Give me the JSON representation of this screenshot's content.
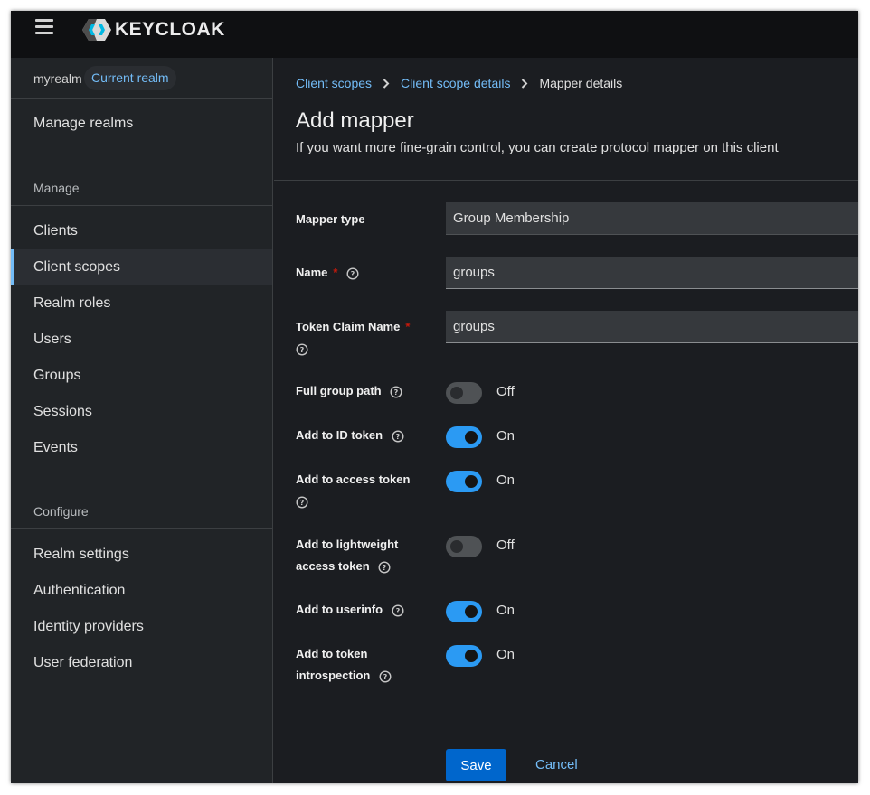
{
  "brand": {
    "logo_text": "KEYCLOAK"
  },
  "realm": {
    "name": "myrealm",
    "badge": "Current realm"
  },
  "sidebar": {
    "manage_realms": "Manage realms",
    "manage_heading": "Manage",
    "manage_items": [
      {
        "label": "Clients",
        "active": false
      },
      {
        "label": "Client scopes",
        "active": true
      },
      {
        "label": "Realm roles",
        "active": false
      },
      {
        "label": "Users",
        "active": false
      },
      {
        "label": "Groups",
        "active": false
      },
      {
        "label": "Sessions",
        "active": false
      },
      {
        "label": "Events",
        "active": false
      }
    ],
    "configure_heading": "Configure",
    "configure_items": [
      {
        "label": "Realm settings"
      },
      {
        "label": "Authentication"
      },
      {
        "label": "Identity providers"
      },
      {
        "label": "User federation"
      }
    ]
  },
  "breadcrumb": {
    "items": [
      "Client scopes",
      "Client scope details"
    ],
    "current": "Mapper details"
  },
  "page": {
    "title": "Add mapper",
    "subtitle": "If you want more fine-grain control, you can create protocol mapper on this client"
  },
  "form": {
    "mapper_type": {
      "label": "Mapper type",
      "value": "Group Membership"
    },
    "name": {
      "label": "Name",
      "value": "groups",
      "required": true
    },
    "token_claim_name": {
      "label": "Token Claim Name",
      "value": "groups",
      "required": true
    },
    "toggles": [
      {
        "label": "Full group path",
        "state": "Off",
        "on": false
      },
      {
        "label": "Add to ID token",
        "state": "On",
        "on": true
      },
      {
        "label": "Add to access token",
        "state": "On",
        "on": true
      },
      {
        "label": "Add to lightweight access token",
        "state": "Off",
        "on": false
      },
      {
        "label": "Add to userinfo",
        "state": "On",
        "on": true
      },
      {
        "label": "Add to token introspection",
        "state": "On",
        "on": true
      }
    ]
  },
  "actions": {
    "save": "Save",
    "cancel": "Cancel"
  },
  "colors": {
    "accent": "#73bcf7",
    "primary_button": "#0066cc",
    "toggle_on": "#2b9af3",
    "required": "#c9190b"
  }
}
